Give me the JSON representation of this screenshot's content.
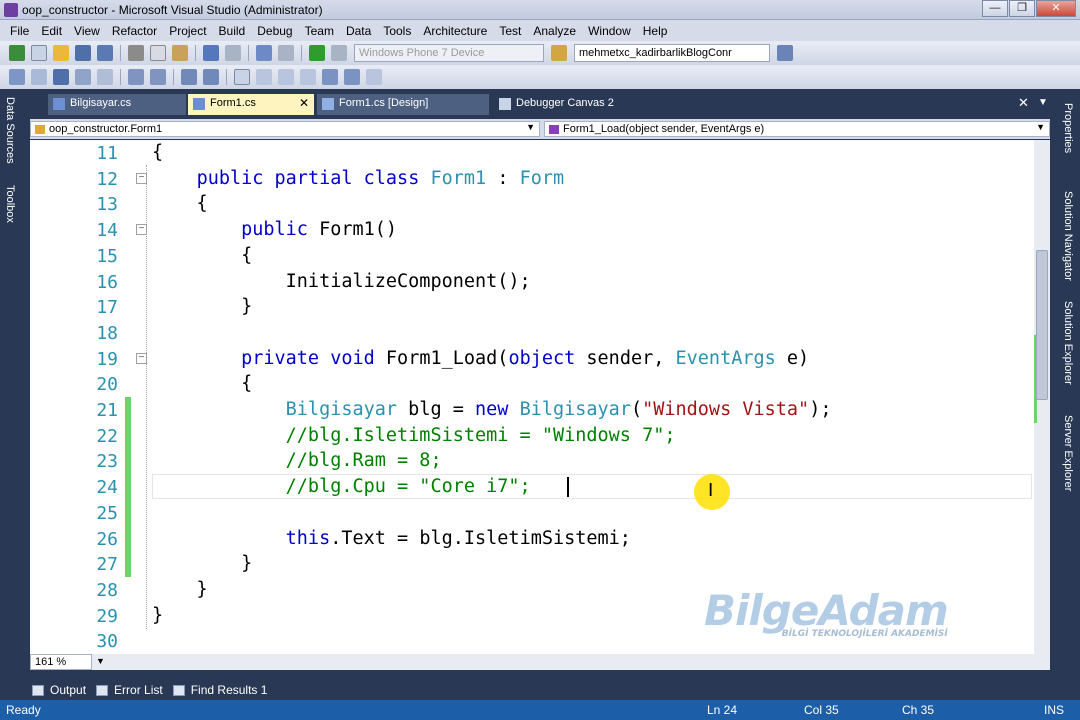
{
  "window": {
    "title": "oop_constructor - Microsoft Visual Studio (Administrator)"
  },
  "menu": [
    "File",
    "Edit",
    "View",
    "Refactor",
    "Project",
    "Build",
    "Debug",
    "Team",
    "Data",
    "Tools",
    "Architecture",
    "Test",
    "Analyze",
    "Window",
    "Help"
  ],
  "toolbar": {
    "device_combo": "Windows Phone 7 Device",
    "connection_combo": "mehmetxc_kadirbarlikBlogConr"
  },
  "left_panels": [
    "Data Sources",
    "Toolbox"
  ],
  "right_panels": [
    "Properties",
    "Solution Navigator",
    "Solution Explorer",
    "Server Explorer"
  ],
  "tabs": [
    {
      "label": "Bilgisayar.cs"
    },
    {
      "label": "Form1.cs"
    },
    {
      "label": "Form1.cs [Design]"
    },
    {
      "label": "Debugger Canvas 2"
    }
  ],
  "nav": {
    "class_combo": "oop_constructor.Form1",
    "member_combo": "Form1_Load(object sender, EventArgs e)"
  },
  "code": {
    "lines": [
      {
        "num": "11",
        "text": "{"
      },
      {
        "num": "12",
        "text": "    public partial class Form1 : Form"
      },
      {
        "num": "13",
        "text": "    {"
      },
      {
        "num": "14",
        "text": "        public Form1()"
      },
      {
        "num": "15",
        "text": "        {"
      },
      {
        "num": "16",
        "text": "            InitializeComponent();"
      },
      {
        "num": "17",
        "text": "        }"
      },
      {
        "num": "18",
        "text": ""
      },
      {
        "num": "19",
        "text": "        private void Form1_Load(object sender, EventArgs e)"
      },
      {
        "num": "20",
        "text": "        {"
      },
      {
        "num": "21",
        "text": "            Bilgisayar blg = new Bilgisayar(\"Windows Vista\");"
      },
      {
        "num": "22",
        "text": "            //blg.IsletimSistemi = \"Windows 7\";"
      },
      {
        "num": "23",
        "text": "            //blg.Ram = 8;"
      },
      {
        "num": "24",
        "text": "            //blg.Cpu = \"Core i7\";"
      },
      {
        "num": "25",
        "text": ""
      },
      {
        "num": "26",
        "text": "            this.Text = blg.IsletimSistemi;"
      },
      {
        "num": "27",
        "text": "        }"
      },
      {
        "num": "28",
        "text": "    }"
      },
      {
        "num": "29",
        "text": "}"
      },
      {
        "num": "30",
        "text": ""
      }
    ]
  },
  "watermark": {
    "brand": "BilgeAdam",
    "subtitle": "BİLGİ TEKNOLOJİLERİ AKADEMİSİ"
  },
  "zoom": "161 %",
  "bottom_tabs": [
    "Output",
    "Error List",
    "Find Results 1"
  ],
  "status": {
    "ready": "Ready",
    "ln": "Ln 24",
    "col": "Col 35",
    "ch": "Ch 35",
    "mode": "INS"
  }
}
